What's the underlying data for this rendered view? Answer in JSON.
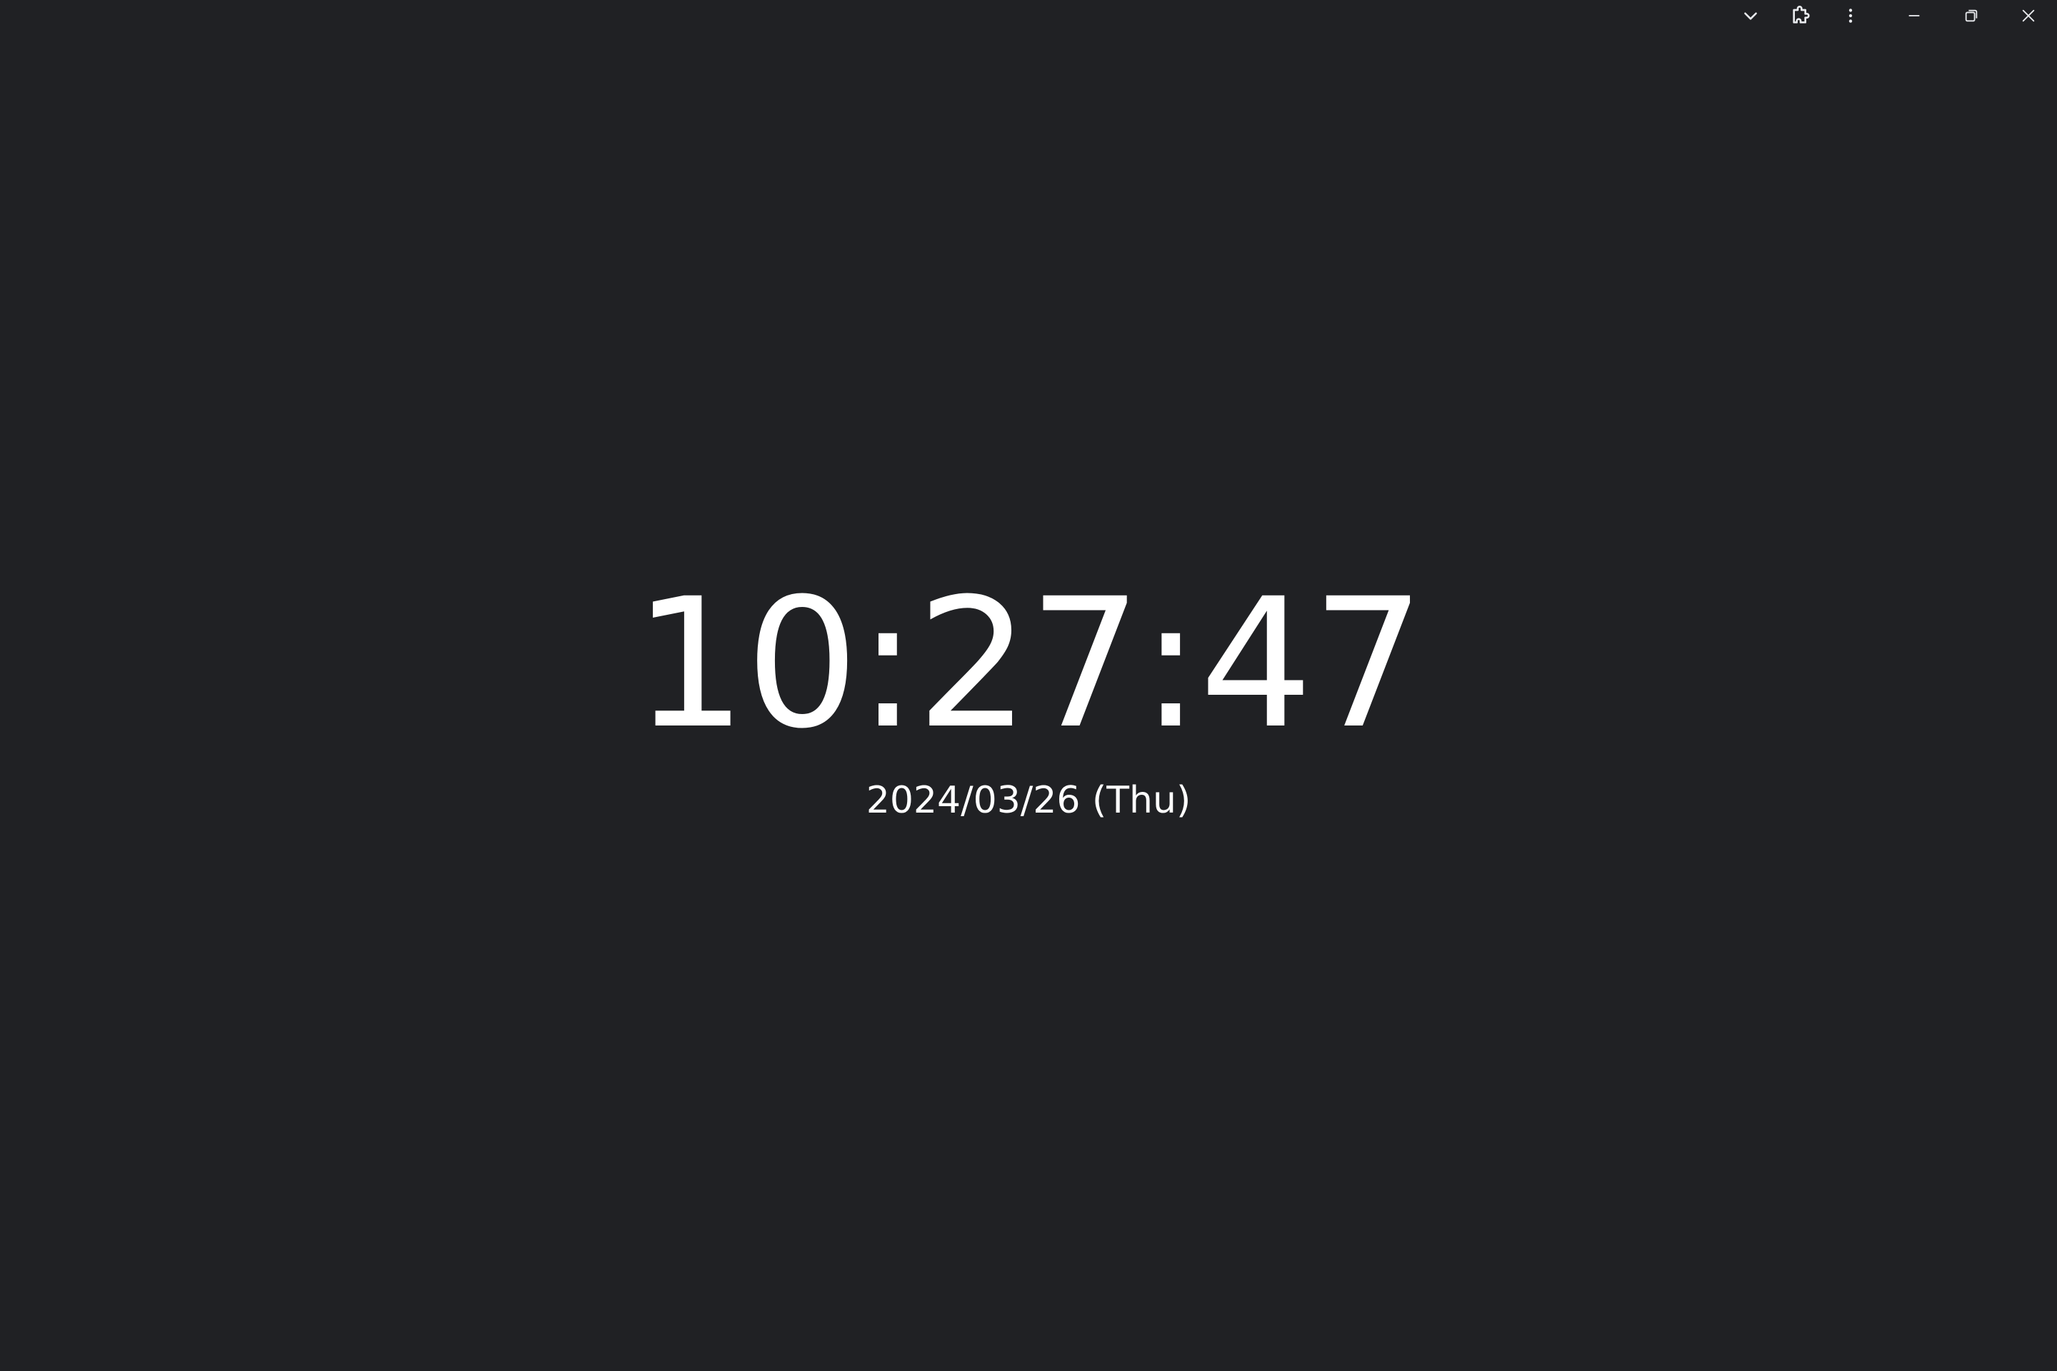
{
  "window": {
    "background": "#202124",
    "controls": {
      "icons": [
        "chevron-down-icon",
        "puzzle-icon",
        "kebab-menu-icon",
        "minimize-icon",
        "restore-icon",
        "close-icon"
      ]
    }
  },
  "clock": {
    "time": "10:27:47",
    "date": "2024/03/26 (Thu)"
  }
}
